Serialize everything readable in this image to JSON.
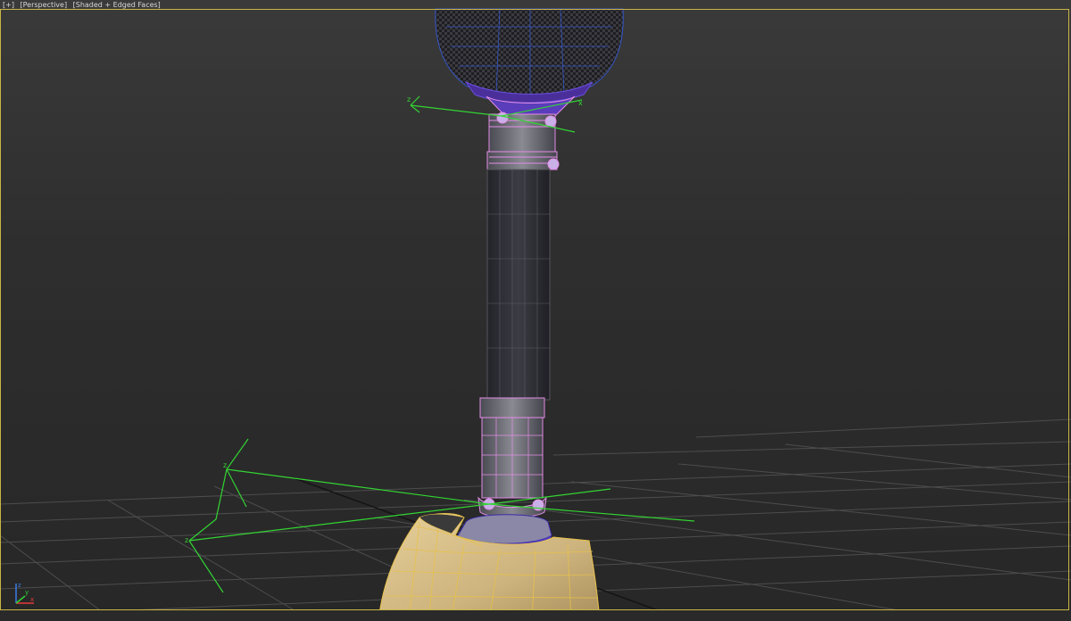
{
  "viewport": {
    "labels": {
      "menu": "[+]",
      "view": "[Perspective]",
      "shading": "[Shaded + Edged Faces]"
    },
    "colors": {
      "active_border": "#c9b646",
      "background_top": "#3a3a3a",
      "background_bottom": "#272727",
      "grid": "#4a4a4a",
      "grid_center": "#151515",
      "selection_wire": "#e38de6",
      "gizmo_green": "#33d433",
      "shoe_color": "#d9c08a",
      "shoe_wire": "#e6c14c",
      "carbon_wire": "#3656c8"
    },
    "objects": [
      {
        "name": "socket",
        "shading": "carbon-fiber"
      },
      {
        "name": "pylon",
        "shading": "dark-grey"
      },
      {
        "name": "upper-clamp",
        "selected": true
      },
      {
        "name": "lower-clamp",
        "selected": true
      },
      {
        "name": "foot-adapter",
        "shading": "purple"
      },
      {
        "name": "foot-shell",
        "shading": "beige"
      }
    ],
    "axis_tripod": {
      "x_label": "x",
      "y_label": "y",
      "z_label": "z",
      "icon": "axis-tripod-icon"
    }
  }
}
